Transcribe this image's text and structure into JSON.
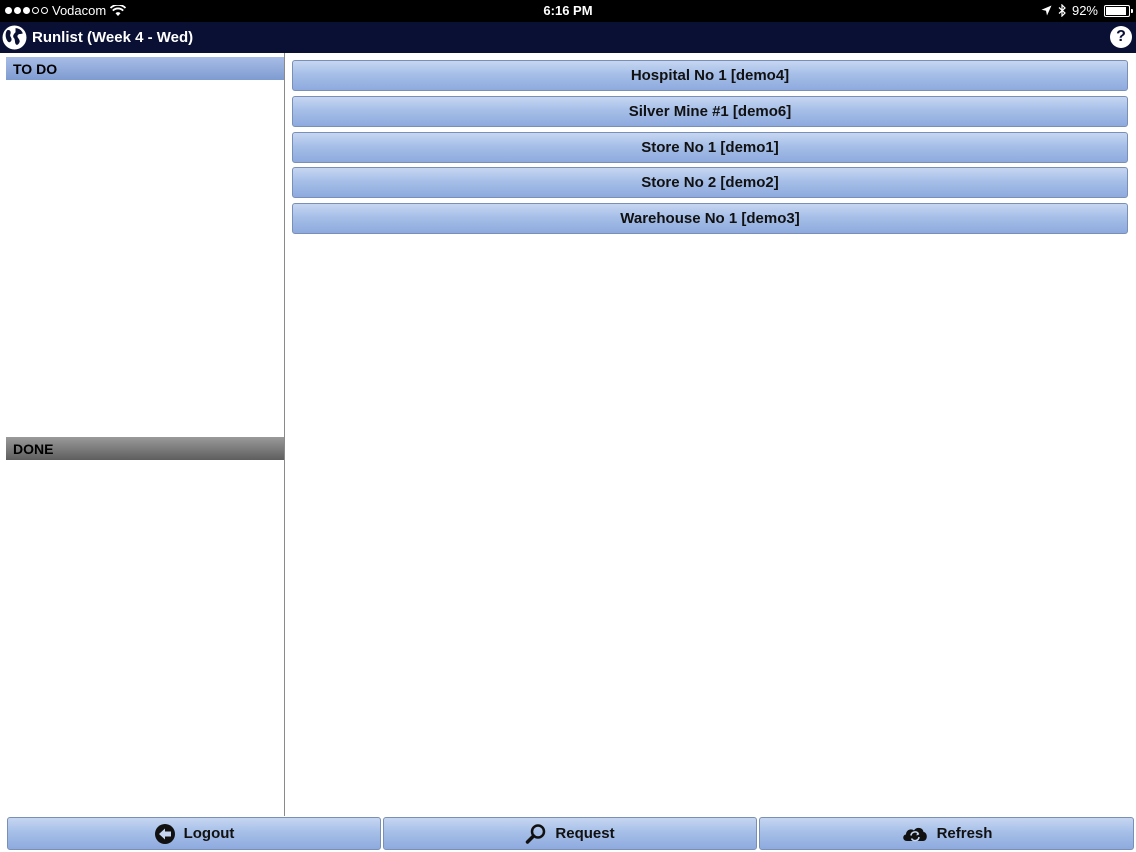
{
  "status_bar": {
    "carrier": "Vodacom",
    "time": "6:16 PM",
    "battery": "92%",
    "battery_level": 0.92,
    "icons": [
      "signal-dots-icon",
      "wifi-icon",
      "location-arrow-icon",
      "bluetooth-icon",
      "battery-icon"
    ]
  },
  "header": {
    "title": "Runlist (Week 4 - Wed)",
    "help_label": "?",
    "icons": [
      "globe-icon",
      "help-icon"
    ],
    "background": "#0a1033"
  },
  "sections": {
    "todo": "TO DO",
    "done": "DONE"
  },
  "sites": [
    {
      "label": "Hospital No 1 [demo4]"
    },
    {
      "label": "Silver Mine #1 [demo6]"
    },
    {
      "label": "Store No 1 [demo1]"
    },
    {
      "label": "Store No 2 [demo2]"
    },
    {
      "label": "Warehouse No 1 [demo3]"
    }
  ],
  "toolbar": {
    "logout": "Logout",
    "request": "Request",
    "refresh": "Refresh",
    "icons": [
      "back-arrow-icon",
      "search-icon",
      "cloud-refresh-icon"
    ]
  },
  "colors": {
    "button_blue": "#a6bfe8",
    "todo_header": "#7e9bd1",
    "done_header": "#5e5e5e"
  }
}
